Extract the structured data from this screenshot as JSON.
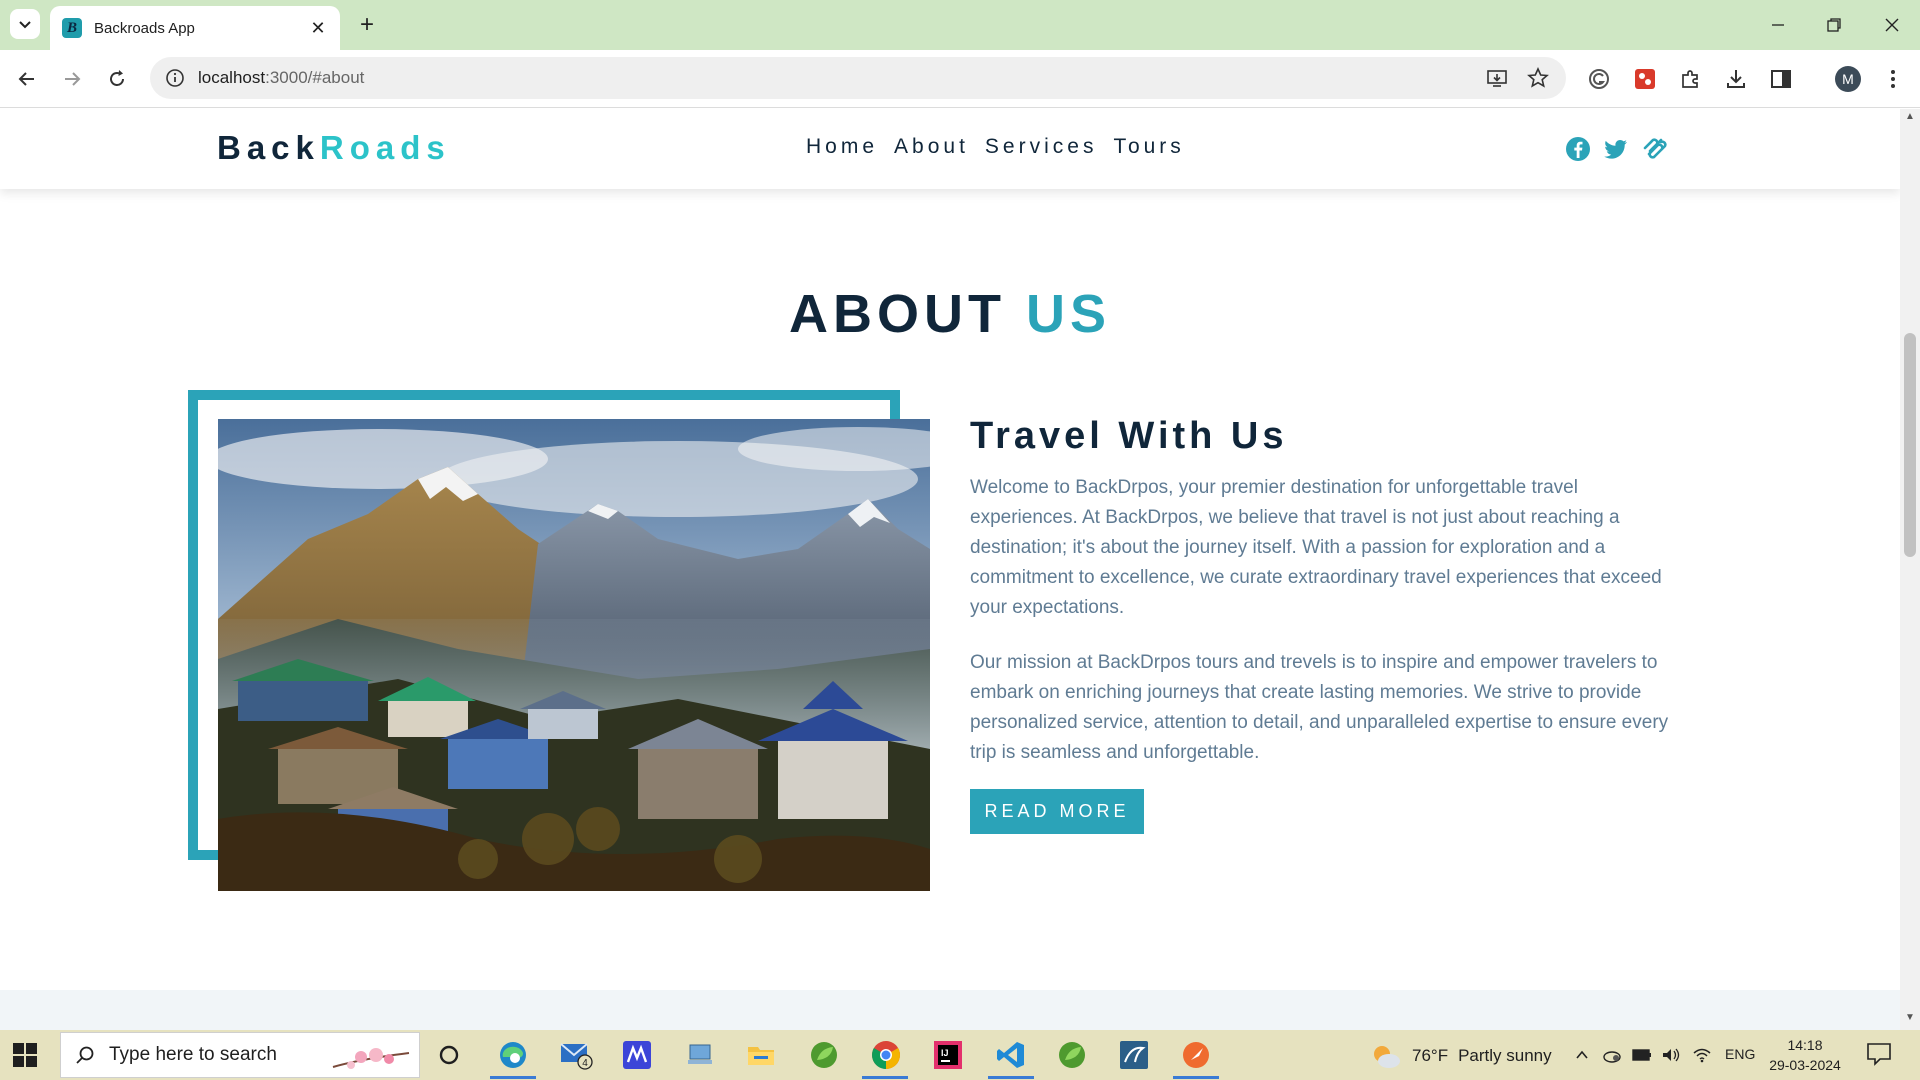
{
  "browser": {
    "tab_title": "Backroads App",
    "url_host": "localhost",
    "url_rest": ":3000/#about",
    "avatar_letter": "M"
  },
  "site": {
    "brand_part1": "Back",
    "brand_part2": "Roads",
    "nav": [
      "Home",
      "About",
      "Services",
      "Tours"
    ],
    "social_icons": [
      "facebook-icon",
      "twitter-icon",
      "squarespace-icon"
    ],
    "colors": {
      "primary": "#2ba3b8",
      "dark": "#10263a",
      "text": "#5f7b93",
      "brand_accent": "#2cc3c9"
    }
  },
  "about": {
    "title_part1": "ABOUT",
    "title_part2": "US",
    "heading": "Travel With Us",
    "paragraph1": "Welcome to BackDrpos, your premier destination for unforgettable travel experiences. At BackDrpos, we believe that travel is not just about reaching a destination; it's about the journey itself. With a passion for exploration and a commitment to excellence, we curate extraordinary travel experiences that exceed your expectations.",
    "paragraph2": "Our mission at BackDrpos tours and trevels is to inspire and empower travelers to embark on enriching journeys that create lasting memories. We strive to provide personalized service, attention to detail, and unparalleled expertise to ensure every trip is seamless and unforgettable.",
    "button_label": "READ MORE"
  },
  "taskbar": {
    "search_placeholder": "Type here to search",
    "mail_badge": "4",
    "weather_temp": "76°F",
    "weather_text": "Partly sunny",
    "language": "ENG",
    "time": "14:18",
    "date": "29-03-2024"
  }
}
